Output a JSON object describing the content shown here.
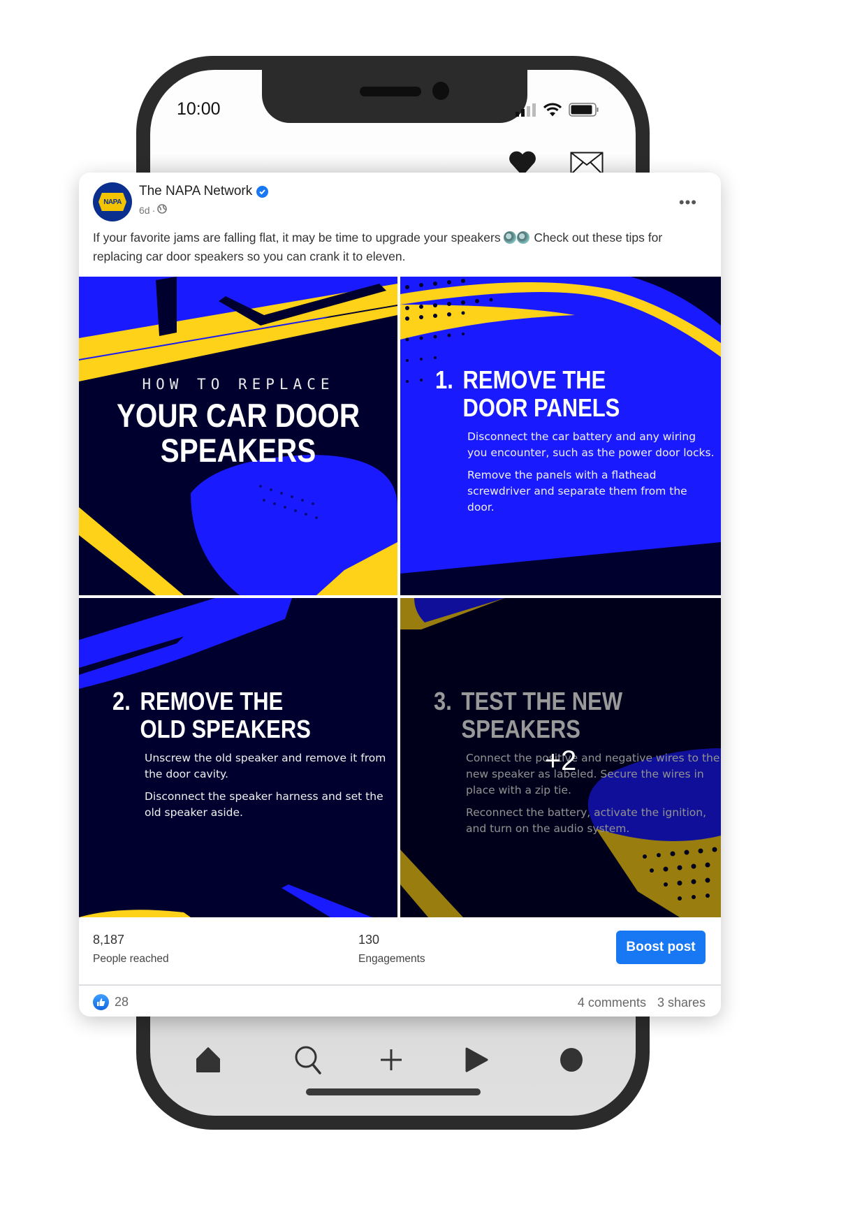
{
  "status_bar": {
    "time": "10:00",
    "icons": [
      "signal-icon",
      "wifi-icon",
      "battery-icon"
    ]
  },
  "app_header": {
    "icons": [
      "heart-icon",
      "mail-icon"
    ]
  },
  "post": {
    "page_name": "The NAPA Network",
    "verified": true,
    "avatar_text": "NAPA",
    "age": "6d",
    "separator": "·",
    "audience_icon": "globe-icon",
    "more_label": "•••",
    "caption_part1": "If your favorite jams are falling flat, it may be time to upgrade your speakers",
    "caption_emoji": [
      "speaker-emoji",
      "speaker-emoji"
    ],
    "caption_part2": "Check out these tips for replacing car door speakers so you can crank it to eleven.",
    "images": [
      {
        "kicker": "HOW TO REPLACE",
        "headline_line1": "YOUR CAR DOOR",
        "headline_line2": "SPEAKERS"
      },
      {
        "number": "1.",
        "title_line1": "REMOVE THE",
        "title_line2": "DOOR PANELS",
        "paragraphs": [
          "Disconnect the car battery and any wiring you encounter, such as the power door locks.",
          "Remove the panels with a flathead screwdriver and separate them from the door."
        ]
      },
      {
        "number": "2.",
        "title_line1": "REMOVE THE",
        "title_line2": "OLD SPEAKERS",
        "paragraphs": [
          "Unscrew the old speaker and remove it from the door cavity.",
          "Disconnect the speaker harness and set the old speaker aside."
        ]
      },
      {
        "number": "3.",
        "title_line1": "TEST THE NEW",
        "title_line2": "SPEAKERS",
        "paragraphs": [
          "Connect the positive and negative wires to the new speaker as labeled. Secure the wires in place with a zip tie.",
          "Reconnect the battery, activate the ignition, and turn on the audio system."
        ],
        "more_count": "+2"
      }
    ],
    "stats": {
      "reach_value": "8,187",
      "reach_label": "People reached",
      "engagement_value": "130",
      "engagement_label": "Engagements"
    },
    "boost_label": "Boost post",
    "reactions_count": "28",
    "comments": "4 comments",
    "shares": "3 shares"
  },
  "bottom_nav": [
    "home-icon",
    "search-icon",
    "add-icon",
    "play-icon",
    "profile-icon"
  ],
  "colors": {
    "napa_blue": "#0a2f8f",
    "napa_yellow": "#f5c400",
    "tile_navy": "#00002e",
    "tile_blue": "#1a1aff",
    "boost_blue": "#1877f2"
  }
}
